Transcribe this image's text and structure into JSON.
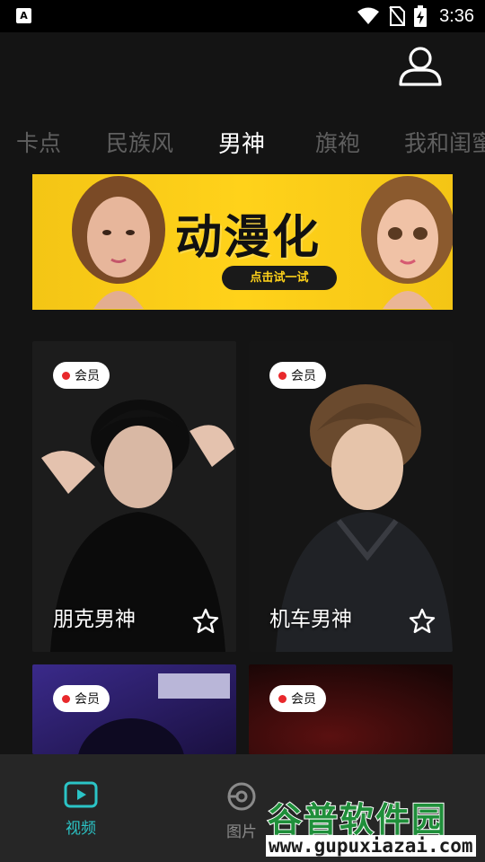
{
  "status_bar": {
    "notification_icon": "A",
    "time": "3:36",
    "icons": [
      "wifi-icon",
      "no-sim-icon",
      "battery-charging-icon"
    ]
  },
  "header": {
    "profile_icon": "user-profile-icon"
  },
  "tabs": [
    {
      "label": "卡点",
      "active": false
    },
    {
      "label": "民族风",
      "active": false
    },
    {
      "label": "男神",
      "active": true
    },
    {
      "label": "旗袍",
      "active": false
    },
    {
      "label": "我和闺蜜",
      "active": false
    }
  ],
  "banner": {
    "title": "动漫化",
    "cta": "点击试一试",
    "colors": {
      "background": "#ffd21a",
      "title": "#111111"
    }
  },
  "cards": [
    {
      "badge": "会员",
      "title": "朋克男神",
      "starred": false
    },
    {
      "badge": "会员",
      "title": "机车男神",
      "starred": false
    },
    {
      "badge": "会员",
      "title": "",
      "starred": false
    },
    {
      "badge": "会员",
      "title": "",
      "starred": false
    }
  ],
  "bottom_nav": [
    {
      "label": "视频",
      "icon": "video-icon",
      "active": true
    },
    {
      "label": "图片",
      "icon": "image-icon",
      "active": false
    }
  ],
  "colors": {
    "accent": "#2bc4c6",
    "badge_dot": "#e8282b",
    "tab_inactive": "#5f5f5f"
  },
  "watermark": {
    "title": "谷普软件园",
    "url": "www.gupuxiazai.com"
  }
}
